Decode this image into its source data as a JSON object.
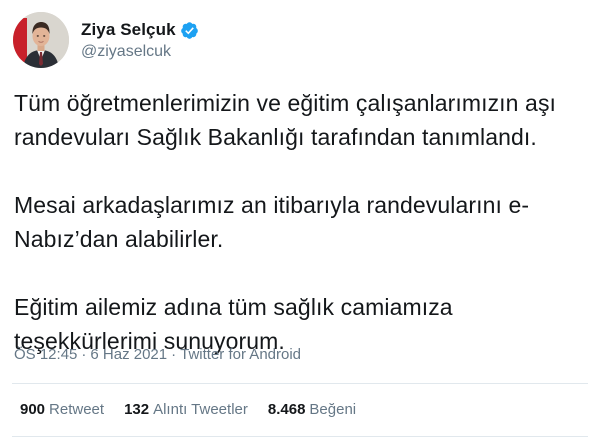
{
  "author": {
    "display_name": "Ziya Selçuk",
    "handle": "@ziyaselcuk",
    "verified": true,
    "avatar": "profile-photo"
  },
  "tweet": {
    "paragraphs": [
      "Tüm öğretmenlerimizin ve eğitim çalışanlarımızın aşı\nrandevuları Sağlık Bakanlığı tarafından tanımlandı.",
      "Mesai arkadaşlarımız an itibarıyla randevularını e-\nNabız’dan alabilirler.",
      "Eğitim ailemiz adına tüm sağlık camiamıza\nteşekkürlerimi sunuyorum."
    ]
  },
  "meta": {
    "time": "ÖS 12:45",
    "separator": "·",
    "date": "6 Haz 2021",
    "source": "Twitter for Android"
  },
  "stats": {
    "retweets": {
      "count": "900",
      "label": "Retweet"
    },
    "quotes": {
      "count": "132",
      "label": "Alıntı Tweetler"
    },
    "likes": {
      "count": "8.468",
      "label": "Beğeni"
    }
  },
  "colors": {
    "text": "#14171a",
    "secondary": "#657786",
    "verified_blue": "#1da1f2",
    "divider": "#e1e8ed"
  }
}
